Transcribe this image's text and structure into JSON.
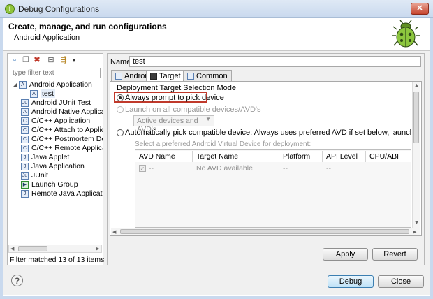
{
  "window": {
    "title": "Debug Configurations",
    "close_glyph": "✕"
  },
  "header": {
    "title": "Create, manage, and run configurations",
    "subtitle": "Android Application"
  },
  "left": {
    "filter_placeholder": "type filter text",
    "tree": [
      {
        "label": "Android Application",
        "expanded": true,
        "icon": "android-app-icon"
      },
      {
        "label": "test",
        "child": true,
        "selected": true,
        "icon": "android-config-icon"
      },
      {
        "label": "Android JUnit Test",
        "icon": "junit-icon"
      },
      {
        "label": "Android Native Application",
        "icon": "native-app-icon"
      },
      {
        "label": "C/C++ Application",
        "icon": "c-icon"
      },
      {
        "label": "C/C++ Attach to Application",
        "icon": "c-icon"
      },
      {
        "label": "C/C++ Postmortem Debugger",
        "icon": "c-icon"
      },
      {
        "label": "C/C++ Remote Application",
        "icon": "c-icon"
      },
      {
        "label": "Java Applet",
        "icon": "java-applet-icon"
      },
      {
        "label": "Java Application",
        "icon": "java-app-icon"
      },
      {
        "label": "JUnit",
        "icon": "junit-icon"
      },
      {
        "label": "Launch Group",
        "icon": "launch-group-icon"
      },
      {
        "label": "Remote Java Application",
        "icon": "remote-java-icon"
      }
    ],
    "status": "Filter matched 13 of 13 items"
  },
  "right": {
    "name_label": "Name:",
    "name_value": "test",
    "tabs": [
      {
        "label": "Android",
        "active": false
      },
      {
        "label": "Target",
        "active": true
      },
      {
        "label": "Common",
        "active": false
      }
    ],
    "deploy_title": "Deployment Target Selection Mode",
    "options": {
      "always": "Always prompt to pick device",
      "launch_all": "Launch on all compatible devices/AVD's",
      "active_select": "Active devices and AVD's",
      "auto": "Automatically pick compatible device: Always uses preferred AVD if set below, launches on compatible device/AVD"
    },
    "avd_hint": "Select a preferred Android Virtual Device for deployment:",
    "table": {
      "columns": [
        "AVD Name",
        "Target Name",
        "Platform",
        "API Level",
        "CPU/ABI"
      ],
      "row": [
        "--",
        "No AVD available",
        "--",
        "--",
        ""
      ]
    }
  },
  "buttons": {
    "apply": "Apply",
    "revert": "Revert",
    "debug": "Debug",
    "close": "Close",
    "help": "?"
  },
  "colors": {
    "highlight": "#c0392b",
    "accent": "#3c7fb1"
  }
}
